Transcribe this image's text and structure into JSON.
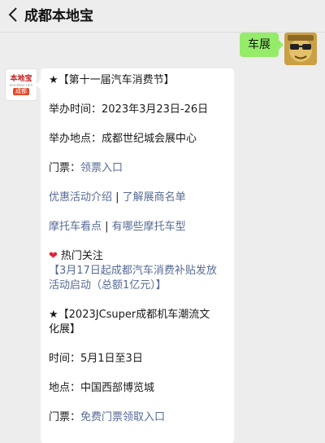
{
  "header": {
    "back_icon": "chevron-left-icon",
    "title": "成都本地宝"
  },
  "outgoing_message": {
    "text": "车展",
    "avatar_icon": "meme-avatar"
  },
  "incoming_message": {
    "sender_avatar": {
      "logo_text": "本地宝",
      "logo_sub": "bendibao.com",
      "logo_city": "成都"
    },
    "event1": {
      "title": "★【第十一届汽车消费节】",
      "time": "举办时间：2023年3月23日-26日",
      "place": "举办地点：成都世纪城会展中心",
      "ticket_prefix": "门票：",
      "ticket_link": "领票入口",
      "promo_link": "优惠活动介绍",
      "separator": " | ",
      "exhibitor_link": "了解展商名单",
      "moto_link": "摩托车看点",
      "moto_models_link": "有哪些摩托车型"
    },
    "hot_topic": {
      "label": "热门关注",
      "link_line1": "【3月17日起成都汽车消费补贴发放",
      "link_line2": "活动启动（总额1亿元）】"
    },
    "event2": {
      "title_line1": "★【2023JCsuper成都机车潮流文",
      "title_line2": "化展】",
      "time": "时间：5月1日至3日",
      "place": "地点：中国西部博览城",
      "ticket_prefix": "门票：",
      "ticket_link": "免费门票领取入口"
    }
  },
  "colors": {
    "background": "#ededed",
    "bubble_green": "#95ec69",
    "link_blue": "#576b95",
    "heart_red": "#e0243a"
  }
}
